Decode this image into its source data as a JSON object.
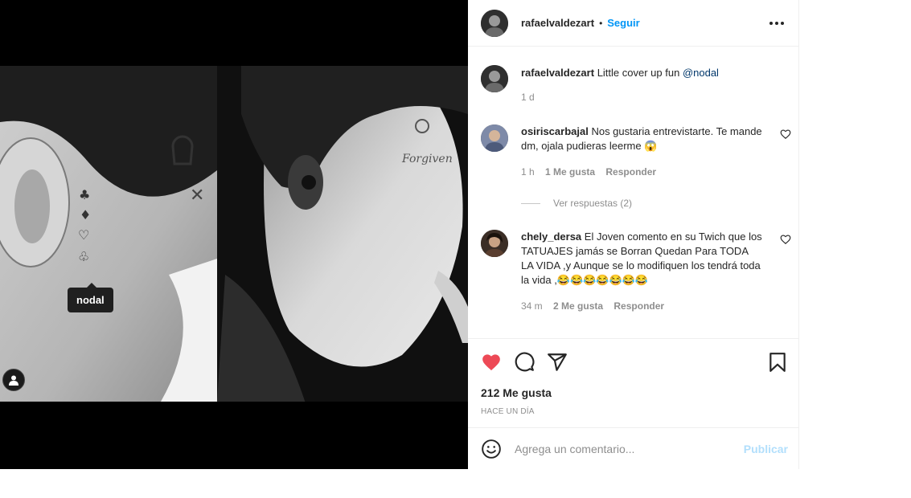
{
  "post": {
    "username": "rafaelvaldezart",
    "follow_label": "Seguir",
    "dot": "•",
    "more_label": "•••",
    "image_tag": "nodal",
    "caption": {
      "username": "rafaelvaldezart",
      "text": "Little cover up fun",
      "mention": "@nodal",
      "time": "1 d"
    }
  },
  "comments": [
    {
      "username": "osiriscarbajal",
      "text": "Nos gustaria entrevistarte. Te mande dm, ojala pudieras leerme 😱",
      "time": "1 h",
      "likes": "1 Me gusta",
      "reply": "Responder",
      "view_replies": "Ver respuestas (2)"
    },
    {
      "username": "chely_dersa",
      "text": "El Joven comento en su Twich que los TATUAJES jamás se Borran Quedan Para TODA LA VIDA ,y Aunque se lo modifiquen los tendrá toda la vida ,😂😂😂😂😂😂😂",
      "time": "34 m",
      "likes": "2 Me gusta",
      "reply": "Responder"
    }
  ],
  "actions": {
    "likes": "212 Me gusta",
    "posted": "HACE UN DÍA",
    "like_color": "#ed4956"
  },
  "composer": {
    "placeholder": "Agrega un comentario...",
    "publish_label": "Publicar"
  },
  "icons": [
    "user-tag-icon",
    "more-icon",
    "heart-icon",
    "comment-icon",
    "share-icon",
    "bookmark-icon",
    "emoji-icon"
  ]
}
